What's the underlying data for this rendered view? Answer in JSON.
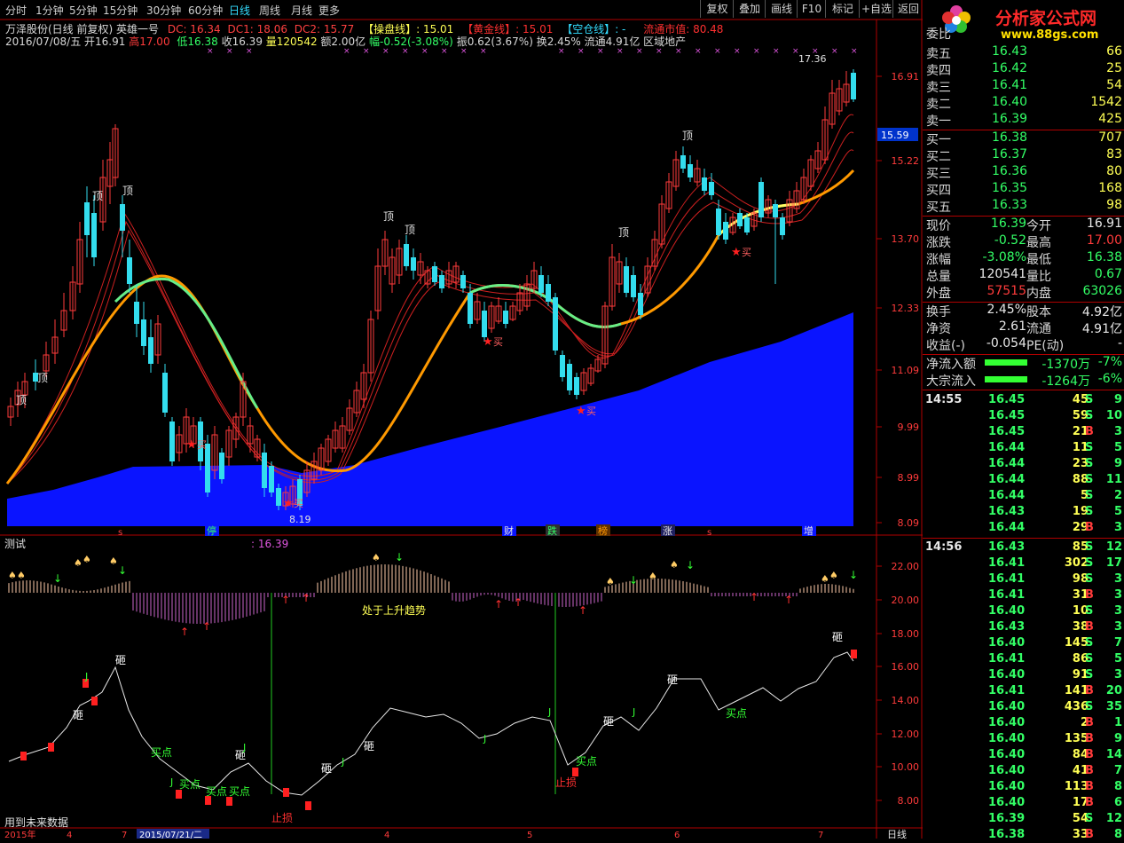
{
  "toolbar": {
    "periods": [
      "分时",
      "1分钟",
      "5分钟",
      "15分钟",
      "30分钟",
      "60分钟",
      "日线",
      "周线",
      "月线",
      "更多"
    ],
    "active": "日线",
    "right_buttons": [
      "复权",
      "叠加",
      "画线",
      "F10",
      "标记",
      "+自选",
      "返回"
    ]
  },
  "logo": {
    "text": "分析家公式网",
    "url": "www.88gs.com"
  },
  "info": {
    "stock": "万泽股份(日线 前复权) 英雄一号",
    "dc": "DC: 16.34",
    "dc1": "DC1: 18.06",
    "dc2": "DC2: 15.77",
    "caopan": "【操盘线】: 15.01",
    "huangjin": "【黄金线】: 15.01",
    "kongcang": "【空仓线】: -",
    "liutong": "流通市值: 80.48",
    "line2_a": "2016/07/08/五 开16.91",
    "line2_high": "高17.00",
    "line2_low": "低16.38",
    "line2_close": "收16.39",
    "line2_vol": "量120542",
    "line2_amt": "额2.00亿",
    "line2_change": "幅-0.52(-3.08%)",
    "line2_rest": "振0.62(3.67%) 换2.45% 流通4.91亿 区域地产"
  },
  "main_y_ticks": [
    "16.91",
    "15.22",
    "13.70",
    "12.33",
    "11.09",
    "9.99",
    "8.99",
    "8.09"
  ],
  "current_price_tag": "15.59",
  "main_annotations": {
    "top": "顶",
    "buy": "买",
    "max_label": "17.36",
    "min_label": "8.19"
  },
  "event_labels": [
    "停",
    "财",
    "跌",
    "榜",
    "涨",
    "增"
  ],
  "sub": {
    "title": "测试",
    "value": ": 16.39",
    "trend_text": "处于上升趋势",
    "y_ticks": [
      "22.00",
      "20.00",
      "18.00",
      "16.00",
      "14.00",
      "12.00",
      "10.00",
      "8.00"
    ],
    "labels": {
      "za": "砸",
      "buy_point": "买点",
      "stop_loss": "止损",
      "j": "J"
    }
  },
  "bottom": {
    "left_text": "用到未来数据",
    "dates": [
      "2015年",
      "4",
      "7",
      "2015/07/21/二",
      "4",
      "5",
      "6",
      "7"
    ],
    "right_text": "日线"
  },
  "quote": {
    "header": "委比",
    "asks": [
      {
        "label": "卖五",
        "price": "16.43",
        "vol": "66"
      },
      {
        "label": "卖四",
        "price": "16.42",
        "vol": "25"
      },
      {
        "label": "卖三",
        "price": "16.41",
        "vol": "54"
      },
      {
        "label": "卖二",
        "price": "16.40",
        "vol": "1542"
      },
      {
        "label": "卖一",
        "price": "16.39",
        "vol": "425"
      }
    ],
    "bids": [
      {
        "label": "买一",
        "price": "16.38",
        "vol": "707"
      },
      {
        "label": "买二",
        "price": "16.37",
        "vol": "83"
      },
      {
        "label": "买三",
        "price": "16.36",
        "vol": "80"
      },
      {
        "label": "买四",
        "price": "16.35",
        "vol": "168"
      },
      {
        "label": "买五",
        "price": "16.33",
        "vol": "98"
      }
    ],
    "stats": [
      {
        "l1": "现价",
        "v1": "16.39",
        "c1": "green",
        "l2": "今开",
        "v2": "16.91",
        "c2": "white"
      },
      {
        "l1": "涨跌",
        "v1": "-0.52",
        "c1": "green",
        "l2": "最高",
        "v2": "17.00",
        "c2": "red"
      },
      {
        "l1": "涨幅",
        "v1": "-3.08%",
        "c1": "green",
        "l2": "最低",
        "v2": "16.38",
        "c2": "green"
      },
      {
        "l1": "总量",
        "v1": "120541",
        "c1": "white",
        "l2": "量比",
        "v2": "0.67",
        "c2": "green"
      },
      {
        "l1": "外盘",
        "v1": "57515",
        "c1": "red",
        "l2": "内盘",
        "v2": "63026",
        "c2": "green"
      }
    ],
    "stats2": [
      {
        "l1": "换手",
        "v1": "2.45%",
        "c1": "white",
        "l2": "股本",
        "v2": "4.92亿",
        "c2": "white"
      },
      {
        "l1": "净资",
        "v1": "2.61",
        "c1": "white",
        "l2": "流通",
        "v2": "4.91亿",
        "c2": "white"
      },
      {
        "l1": "收益(-)",
        "v1": "-0.054",
        "c1": "white",
        "l2": "PE(动)",
        "v2": "-",
        "c2": "white"
      }
    ],
    "flows": [
      {
        "label": "净流入额",
        "value": "-1370万",
        "pct": "-7%"
      },
      {
        "label": "大宗流入",
        "value": "-1264万",
        "pct": "-6%"
      }
    ]
  },
  "ticks": {
    "groups": [
      {
        "time": "14:55",
        "rows": [
          [
            "16.45",
            "45",
            "S",
            "9"
          ],
          [
            "16.45",
            "59",
            "S",
            "10"
          ],
          [
            "16.45",
            "21",
            "B",
            "3"
          ],
          [
            "16.44",
            "11",
            "S",
            "5"
          ],
          [
            "16.44",
            "23",
            "S",
            "9"
          ],
          [
            "16.44",
            "88",
            "S",
            "11"
          ],
          [
            "16.44",
            "5",
            "S",
            "2"
          ],
          [
            "16.43",
            "19",
            "S",
            "5"
          ],
          [
            "16.44",
            "29",
            "B",
            "3"
          ]
        ]
      },
      {
        "time": "14:56",
        "rows": [
          [
            "16.43",
            "85",
            "S",
            "12"
          ],
          [
            "16.41",
            "302",
            "S",
            "17"
          ],
          [
            "16.41",
            "98",
            "S",
            "3"
          ],
          [
            "16.41",
            "31",
            "B",
            "3"
          ],
          [
            "16.40",
            "10",
            "S",
            "3"
          ],
          [
            "16.43",
            "38",
            "B",
            "3"
          ],
          [
            "16.40",
            "145",
            "S",
            "7"
          ],
          [
            "16.41",
            "86",
            "S",
            "5"
          ],
          [
            "16.40",
            "91",
            "S",
            "3"
          ],
          [
            "16.41",
            "141",
            "B",
            "20"
          ],
          [
            "16.40",
            "436",
            "S",
            "35"
          ],
          [
            "16.40",
            "2",
            "B",
            "1"
          ],
          [
            "16.40",
            "135",
            "B",
            "9"
          ],
          [
            "16.40",
            "84",
            "B",
            "14"
          ],
          [
            "16.40",
            "41",
            "B",
            "7"
          ],
          [
            "16.40",
            "113",
            "B",
            "8"
          ],
          [
            "16.40",
            "17",
            "B",
            "6"
          ],
          [
            "16.39",
            "54",
            "S",
            "12"
          ],
          [
            "16.38",
            "33",
            "B",
            "8"
          ]
        ]
      }
    ]
  },
  "colors": {
    "up": "#ff3b3b",
    "down": "#33ddee",
    "volume_area": "#0a14ff",
    "panel_border": "#b00000"
  }
}
